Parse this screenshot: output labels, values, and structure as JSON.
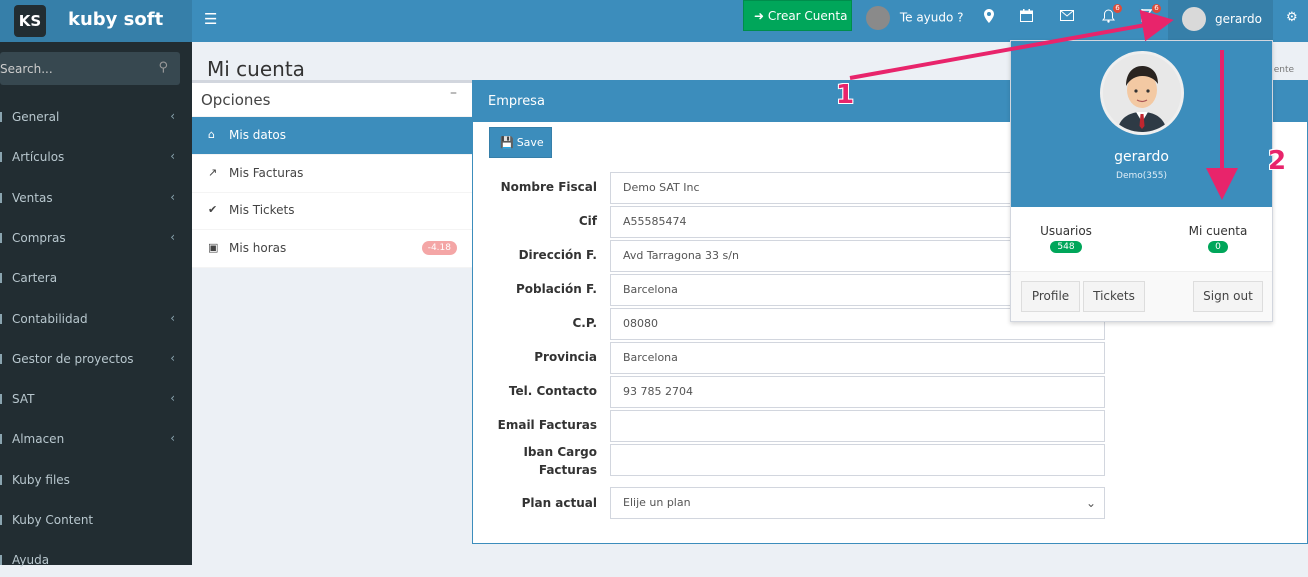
{
  "brand": {
    "logo_mark": "KS",
    "name": "kuby soft"
  },
  "topbar": {
    "crear_cuenta": "Crear Cuenta",
    "te_ayudo": "Te ayudo ?",
    "notif_count_1": "6",
    "notif_count_2": "6",
    "user_name": "gerardo"
  },
  "sidebar": {
    "search_placeholder": "Search...",
    "items": [
      {
        "label": "General",
        "chevron": true
      },
      {
        "label": "Artículos",
        "chevron": true
      },
      {
        "label": "Ventas",
        "chevron": true
      },
      {
        "label": "Compras",
        "chevron": true
      },
      {
        "label": "Cartera",
        "chevron": false
      },
      {
        "label": "Contabilidad",
        "chevron": true
      },
      {
        "label": "Gestor de proyectos",
        "chevron": true
      },
      {
        "label": "SAT",
        "chevron": true
      },
      {
        "label": "Almacen",
        "chevron": true
      },
      {
        "label": "Kuby files",
        "chevron": false
      },
      {
        "label": "Kuby Content",
        "chevron": false
      },
      {
        "label": "Ayuda",
        "chevron": false
      }
    ]
  },
  "page": {
    "title": "Mi cuenta",
    "breadcrumb_tail": "uente"
  },
  "opciones": {
    "title": "Opciones",
    "items": [
      {
        "label": "Mis datos",
        "icon": "home-icon",
        "active": true
      },
      {
        "label": "Mis Facturas",
        "icon": "external-link-icon"
      },
      {
        "label": "Mis Tickets",
        "icon": "check-circle-icon"
      },
      {
        "label": "Mis horas",
        "icon": "briefcase-icon",
        "badge": "-4.18"
      }
    ]
  },
  "empresa": {
    "title": "Empresa",
    "save_label": "Save",
    "fields": [
      {
        "label": "Nombre Fiscal",
        "value": "Demo SAT Inc"
      },
      {
        "label": "Cif",
        "value": "A55585474"
      },
      {
        "label": "Dirección F.",
        "value": "Avd Tarragona 33 s/n"
      },
      {
        "label": "Población F.",
        "value": "Barcelona"
      },
      {
        "label": "C.P.",
        "value": "08080"
      },
      {
        "label": "Provincia",
        "value": "Barcelona"
      },
      {
        "label": "Tel. Contacto",
        "value": "93 785 2704"
      },
      {
        "label": "Email Facturas",
        "value": ""
      },
      {
        "label_line1": "Iban Cargo",
        "label_line2": "Facturas",
        "value": ""
      }
    ],
    "plan_label": "Plan actual",
    "plan_value": "Elije un plan"
  },
  "user_dropdown": {
    "name": "gerardo",
    "sub": "Demo(355)",
    "usuarios_label": "Usuarios",
    "usuarios_count": "548",
    "micuenta_label": "Mi cuenta",
    "micuenta_count": "0",
    "profile": "Profile",
    "tickets": "Tickets",
    "signout": "Sign out"
  },
  "annotations": {
    "one": "1",
    "two": "2"
  },
  "colors": {
    "primary": "#3c8dbc",
    "sidebar": "#222d32",
    "success": "#00a65a",
    "annotation": "#e8246b"
  }
}
